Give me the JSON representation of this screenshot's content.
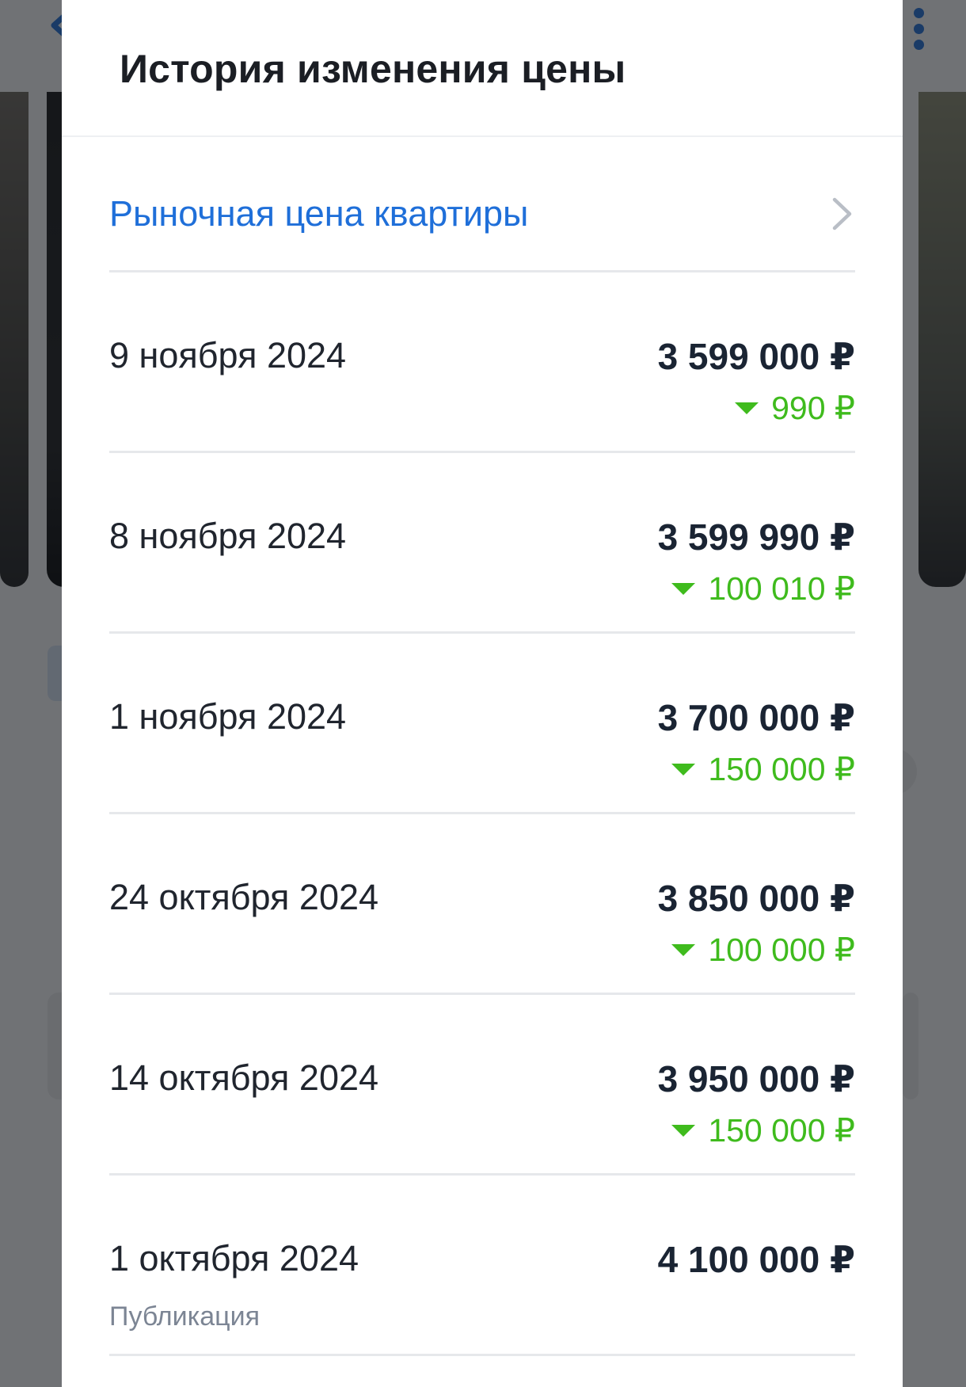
{
  "modal": {
    "title": "История изменения цены",
    "market_link_label": "Рыночная цена квартиры",
    "history": [
      {
        "date": "9 ноября 2024",
        "price": "3 599 000 ₽",
        "change": "990 ₽"
      },
      {
        "date": "8 ноября 2024",
        "price": "3 599 990 ₽",
        "change": "100 010 ₽"
      },
      {
        "date": "1 ноября 2024",
        "price": "3 700 000 ₽",
        "change": "150 000 ₽"
      },
      {
        "date": "24 октября 2024",
        "price": "3 850 000 ₽",
        "change": "100 000 ₽"
      },
      {
        "date": "14 октября 2024",
        "price": "3 950 000 ₽",
        "change": "150 000 ₽"
      },
      {
        "date": "1 октября 2024",
        "price": "4 100 000 ₽",
        "note": "Публикация"
      }
    ]
  },
  "colors": {
    "link": "#1f6fd9",
    "price_drop": "#3fbb1d",
    "text_primary": "#1a2433",
    "text_secondary": "#7c8594"
  },
  "icons": [
    "back-arrow-icon",
    "more-vertical-icon",
    "chevron-right-icon",
    "down-arrow-icon"
  ]
}
